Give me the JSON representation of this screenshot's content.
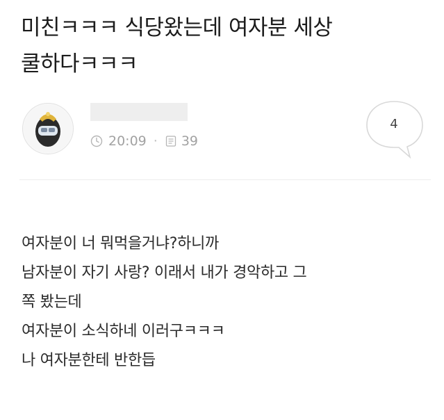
{
  "post": {
    "title_lines": [
      "미친ㅋㅋㅋ 식당왔는데 여자분 세상",
      "쿨하다ㅋㅋㅋ"
    ],
    "time": "20:09",
    "views": "39",
    "comment_count": "4",
    "body_lines": [
      "여자분이 너 뭐먹을거냐?하니까",
      "남자분이 자기 사랑? 이래서 내가 경악하고 그",
      "쪽 봤는데",
      "여자분이 소식하네 이러구ㅋㅋㅋ",
      "나 여자분한테 반한듭"
    ]
  },
  "icons": {
    "avatar": "avatar-icon",
    "time": "clock-icon",
    "views": "document-icon",
    "comments": "speech-bubble-icon"
  }
}
